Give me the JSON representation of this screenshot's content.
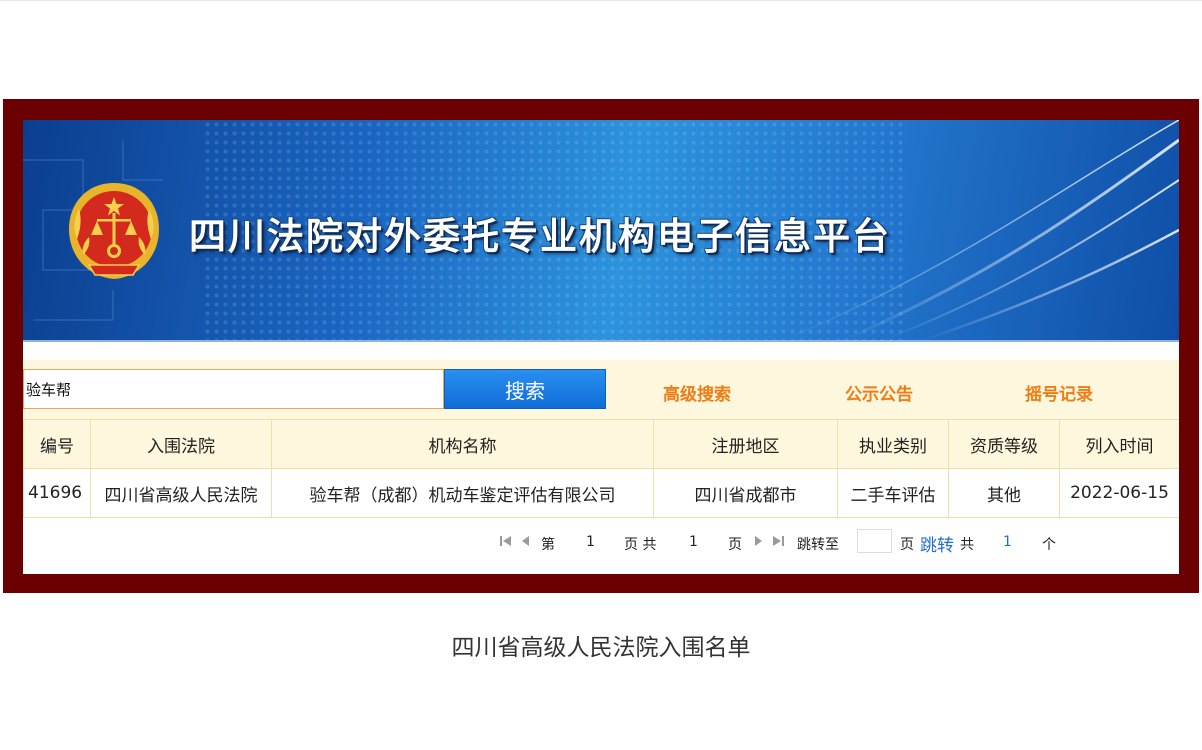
{
  "banner": {
    "title": "四川法院对外委托专业机构电子信息平台",
    "emblem_icon": "court-emblem-icon"
  },
  "search": {
    "value": "验车帮",
    "button_label": "搜索",
    "links": {
      "advanced": "高级搜索",
      "notice": "公示公告",
      "lottery": "摇号记录"
    }
  },
  "table": {
    "headers": [
      "编号",
      "入围法院",
      "机构名称",
      "注册地区",
      "执业类别",
      "资质等级",
      "列入时间"
    ],
    "rows": [
      {
        "id": "41696",
        "court": "四川省高级人民法院",
        "name": "验车帮（成都）机动车鉴定评估有限公司",
        "region": "四川省成都市",
        "category": "二手车评估",
        "level": "其他",
        "date": "2022-06-15"
      }
    ]
  },
  "pager": {
    "page_prefix": "第",
    "current_page": "1",
    "page_unit_total": "页 共",
    "total_pages": "1",
    "page_unit": "页",
    "jump_to": "跳转至",
    "page_label": "页",
    "jump_label": "跳转",
    "total_prefix": "共",
    "total_count": "1",
    "count_unit": "个"
  },
  "caption": "四川省高级人民法院入围名单",
  "colors": {
    "frame": "#6b0000",
    "accent_orange": "#ef7d16",
    "search_blue": "#1f6fd1",
    "table_header_bg": "#fdf7dd"
  }
}
